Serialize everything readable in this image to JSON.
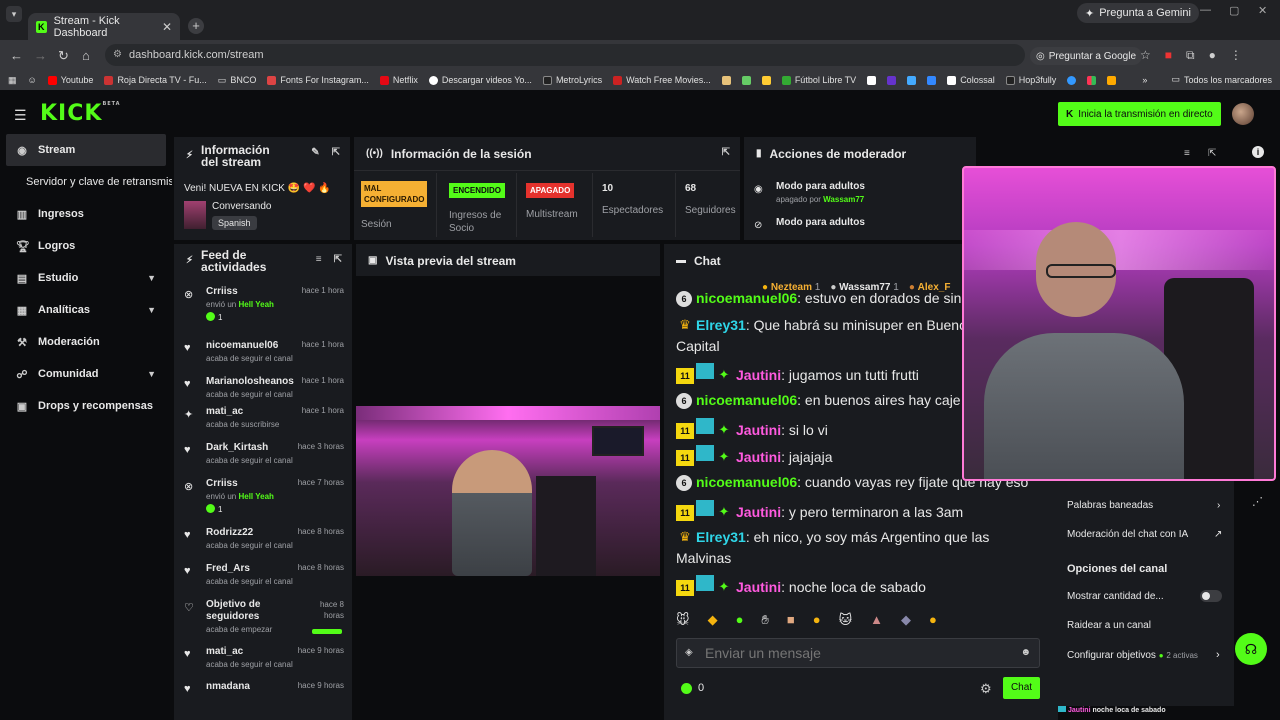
{
  "browser": {
    "tab_title": "Stream - Kick Dashboard",
    "url": "dashboard.kick.com/stream",
    "gemini_btn": "Pregunta a Gemini",
    "pregunta_google": "Preguntar a Google",
    "bookmarks": [
      "Youtube",
      "Roja Directa TV - Fu...",
      "BNCO",
      "Fonts For Instagram...",
      "Netflix",
      "Descargar videos Yo...",
      "MetroLyrics",
      "Watch Free Movies...",
      "Fútbol Libre TV",
      "Colossal",
      "Hop3fully"
    ],
    "all_bookmarks": "Todos los marcadores"
  },
  "header": {
    "logo": "KICK",
    "logo_sup": "BETA",
    "go_live": "Inicia la transmisión en directo"
  },
  "sidebar": {
    "items": [
      {
        "label": "Stream"
      },
      {
        "label": "Servidor y clave de retransmisión"
      },
      {
        "label": "Ingresos"
      },
      {
        "label": "Logros"
      },
      {
        "label": "Estudio"
      },
      {
        "label": "Analíticas"
      },
      {
        "label": "Moderación"
      },
      {
        "label": "Comunidad"
      },
      {
        "label": "Drops y recompensas"
      }
    ]
  },
  "stream_info": {
    "title": "Información del stream",
    "stream_title": "Veni! NUEVA EN KICK 🤩 ❤️ 🔥",
    "category": "Conversando",
    "language": "Spanish"
  },
  "session": {
    "title": "Información de la sesión",
    "sesion_badge": "MAL CONFIGURADO",
    "sesion_label": "Sesión",
    "ingresos_badge": "ENCENDIDO",
    "ingresos_label": "Ingresos de Socio",
    "multistream_badge": "APAGADO",
    "multistream_label": "Multistream",
    "espectadores_num": "10",
    "espectadores_label": "Espectadores",
    "seguidores_num": "68",
    "seguidores_label": "Seguidores"
  },
  "mod": {
    "title": "Acciones de moderador",
    "row1_title": "Modo para adultos",
    "row1_sub": "apagado por",
    "row1_user": "Wassam77",
    "row2_title": "Modo para adultos"
  },
  "feed": {
    "title": "Feed de actividades",
    "rows": [
      {
        "name": "Crriiss",
        "time": "hace 1 hora",
        "desc": "envió un",
        "extra": "Hell Yeah",
        "count": "1"
      },
      {
        "name": "nicoemanuel06",
        "time": "hace 1 hora",
        "desc": "acaba de seguir el canal"
      },
      {
        "name": "Marianolosheanos",
        "time": "hace 1 hora",
        "desc": "acaba de seguir el canal"
      },
      {
        "name": "mati_ac",
        "time": "hace 1 hora",
        "desc": "acaba de suscribirse"
      },
      {
        "name": "Dark_Kirtash",
        "time": "hace 3 horas",
        "desc": "acaba de seguir el canal"
      },
      {
        "name": "Crriiss",
        "time": "hace 7 horas",
        "desc": "envió un",
        "extra": "Hell Yeah",
        "count": "1"
      },
      {
        "name": "Rodrizz22",
        "time": "hace 8 horas",
        "desc": "acaba de seguir el canal"
      },
      {
        "name": "Fred_Ars",
        "time": "hace 8 horas",
        "desc": "acaba de seguir el canal"
      },
      {
        "name": "Objetivo de seguidores",
        "time": "hace 8 horas",
        "desc": "acaba de empezar"
      },
      {
        "name": "mati_ac",
        "time": "hace 9 horas",
        "desc": "acaba de seguir el canal"
      },
      {
        "name": "nmadana",
        "time": "hace 9 horas",
        "desc": ""
      }
    ]
  },
  "preview": {
    "title": "Vista previa del stream"
  },
  "chat": {
    "title": "Chat",
    "top_users": [
      {
        "name": "Nezteam",
        "n": "1"
      },
      {
        "name": "Wassam77",
        "n": "1"
      },
      {
        "name": "Alex_F",
        "n": ""
      }
    ],
    "messages": [
      {
        "badge": "6",
        "user": "nicoemanuel06",
        "color": "#53fc18",
        "text": ": estuvo en dorados de sin"
      },
      {
        "badge": "crown",
        "user": "Elrey31",
        "color": "#2fd6e8",
        "text": ": Que habrá su minisuper en Buenos"
      },
      {
        "badge": "",
        "user": "",
        "color": "",
        "text": "Capital"
      },
      {
        "badge": "11",
        "user": "Jautini",
        "color": "#ff5adf",
        "text": ": jugamos un tutti frutti"
      },
      {
        "badge": "6",
        "user": "nicoemanuel06",
        "color": "#53fc18",
        "text": ": en buenos aires hay caje"
      },
      {
        "badge": "11",
        "user": "Jautini",
        "color": "#ff5adf",
        "text": ": si lo vi"
      },
      {
        "badge": "11",
        "user": "Jautini",
        "color": "#ff5adf",
        "text": ": jajajaja"
      },
      {
        "badge": "6",
        "user": "nicoemanuel06",
        "color": "#53fc18",
        "text": ": cuando vayas rey fijate que hay eso"
      },
      {
        "badge": "11",
        "user": "Jautini",
        "color": "#ff5adf",
        "text": ": y pero terminaron a las 3am"
      },
      {
        "badge": "crown",
        "user": "Elrey31",
        "color": "#2fd6e8",
        "text": ": eh nico, yo soy más Argentino que las"
      },
      {
        "badge": "",
        "user": "",
        "color": "",
        "text": "Malvinas"
      },
      {
        "badge": "11",
        "user": "Jautini",
        "color": "#ff5adf",
        "text": ": noche loca de sabado"
      }
    ],
    "input_placeholder": "Enviar un mensaje",
    "points": "0",
    "send": "Chat"
  },
  "right_panel": {
    "palabras": "Palabras baneadas",
    "moderacion_ia": "Moderación del chat con IA",
    "opciones": "Opciones del canal",
    "mostrar": "Mostrar cantidad de...",
    "raidear": "Raidear a un canal",
    "configurar": "Configurar objetivos",
    "activas": "2 activas"
  },
  "ticker": {
    "user": "Jautini",
    "text": "noche loca de sabado"
  }
}
